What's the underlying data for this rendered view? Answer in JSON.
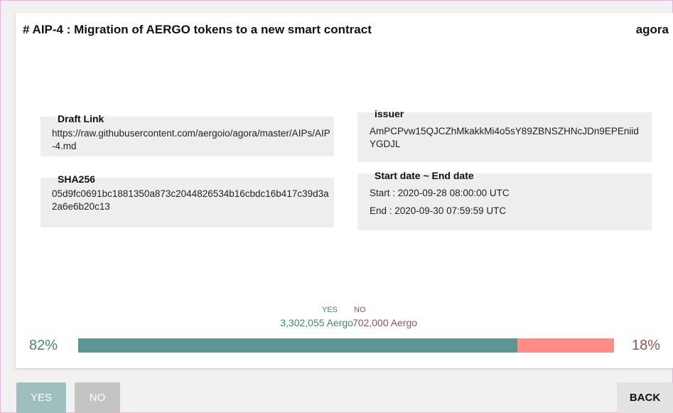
{
  "proposal": {
    "title": "# AIP-4 : Migration of AERGO tokens to a new smart contract",
    "brand": "agora"
  },
  "draft_link": {
    "label": "Draft Link",
    "value": "https://raw.githubusercontent.com/aergoio/agora/master/AIPs/AIP-4.md"
  },
  "sha256": {
    "label": "SHA256",
    "value": "05d9fc0691bc1881350a873c2044826534b16cbdc16b417c39d3a2a6e6b20c13"
  },
  "issuer": {
    "label": "issuer",
    "value": "AmPCPvw15QJCZhMkakkMi4o5sY89ZBNSZHNcJDn9EPEniidYGDJL"
  },
  "dates": {
    "label": "Start date ~ End date",
    "start": "Start : 2020-09-28 08:00:00 UTC",
    "end": "End : 2020-09-30 07:59:59 UTC"
  },
  "vote": {
    "yes_label": "YES",
    "no_label": "NO",
    "yes_amount": "3,302,055 Aergo",
    "no_amount": "702,000 Aergo",
    "yes_pct": "82%",
    "no_pct": "18%",
    "yes_fraction": 0.82,
    "yes_color": "#5e9494",
    "no_color": "#ff8d87",
    "yes_text_color": "#3f8a69",
    "no_text_color": "#8a5656"
  },
  "actions": {
    "yes": "YES",
    "no": "NO",
    "back": "BACK"
  }
}
